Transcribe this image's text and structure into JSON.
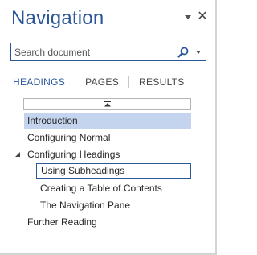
{
  "pane": {
    "title": "Navigation"
  },
  "search": {
    "placeholder": "Search document",
    "value": ""
  },
  "tabs": [
    {
      "label": "HEADINGS",
      "active": true
    },
    {
      "label": "PAGES",
      "active": false
    },
    {
      "label": "RESULTS",
      "active": false
    }
  ],
  "headings": [
    {
      "label": "Introduction",
      "level": 1,
      "selected": true
    },
    {
      "label": "Configuring Normal",
      "level": 1
    },
    {
      "label": "Configuring Headings",
      "level": 1,
      "expanded": true
    },
    {
      "label": "Using Subheadings",
      "level": 2,
      "focused": true
    },
    {
      "label": "Creating a Table of Contents",
      "level": 2
    },
    {
      "label": "The Navigation Pane",
      "level": 2
    },
    {
      "label": "Further Reading",
      "level": 1
    }
  ],
  "icons": {
    "pane_menu": "chevron-down-icon",
    "close": "close-icon",
    "search": "search-icon",
    "search_options": "dropdown-arrow-icon",
    "collapse_all": "collapse-up-icon",
    "expander": "expanded-triangle-icon"
  },
  "colors": {
    "accent": "#2b579a",
    "selected_bg": "#c5d4ee"
  }
}
